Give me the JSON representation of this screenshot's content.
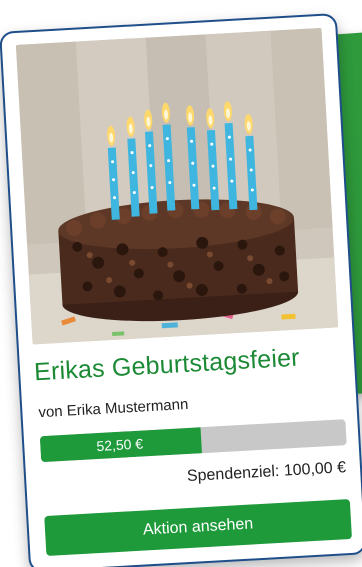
{
  "campaign": {
    "title": "Erikas Geburtstagsfeier",
    "author": "von Erika Mustermann",
    "raised_label": "52,50 €",
    "progress_fraction": 0.525,
    "goal_label": "Spendenziel: 100,00 €",
    "action_label": "Aktion ansehen",
    "image_icon": "birthday-cake-photo"
  },
  "colors": {
    "accent_green": "#1e9a3b",
    "title_green": "#1c8a35",
    "progress_track": "#c8c8c8",
    "card_border": "#1f4f8a"
  }
}
